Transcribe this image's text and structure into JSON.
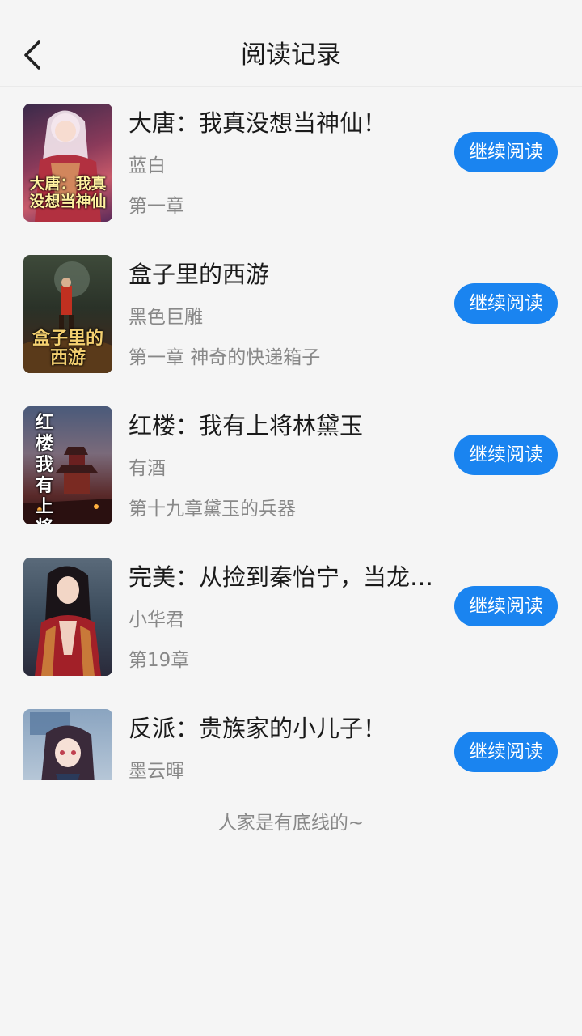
{
  "header": {
    "title": "阅读记录",
    "back_icon": "chevron-left-icon"
  },
  "accent_color": "#1a84f0",
  "books": [
    {
      "title": "大唐：我真没想当神仙！",
      "author": "蓝白",
      "chapter": "第一章",
      "button": "继续阅读",
      "cover_text": "大唐：我真没想当神仙"
    },
    {
      "title": "盒子里的西游",
      "author": "黑色巨雕",
      "chapter": "第一章 神奇的快递箱子",
      "button": "继续阅读",
      "cover_text": "盒子里的西游"
    },
    {
      "title": "红楼：我有上将林黛玉",
      "author": "有酒",
      "chapter": "第十九章黛玉的兵器",
      "button": "继续阅读",
      "cover_text": "红楼 我有上将 林黛玉"
    },
    {
      "title": "完美：从捡到秦怡宁，当龙…",
      "author": "小华君",
      "chapter": "第19章",
      "button": "继续阅读",
      "cover_text": ""
    },
    {
      "title": "反派：贵族家的小儿子！",
      "author": "墨云暉",
      "chapter": "",
      "button": "继续阅读",
      "cover_text": ""
    }
  ],
  "footer_note": "人家是有底线的~"
}
